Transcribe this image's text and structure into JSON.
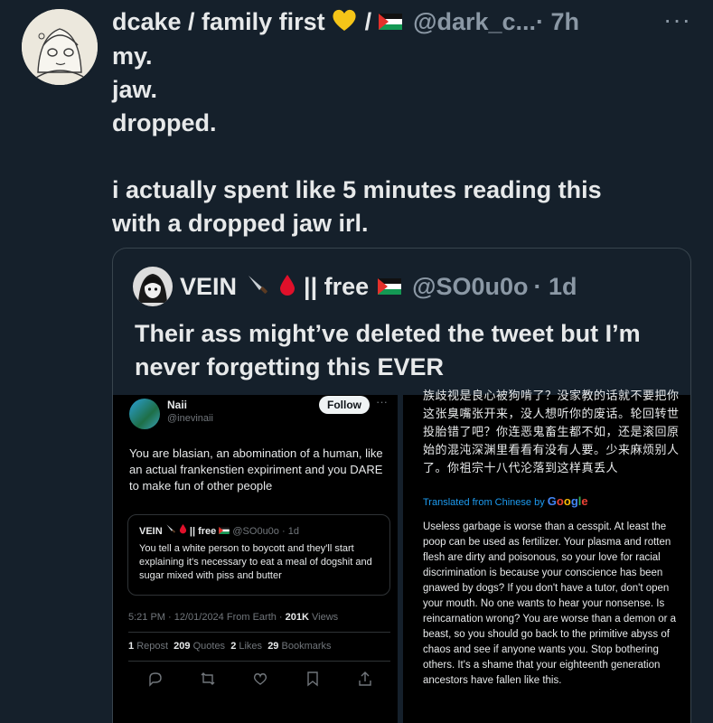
{
  "post": {
    "author_name": "dcake / family first",
    "separator": "/",
    "handle": "@dark_c...",
    "time": "· 7h",
    "more": "···",
    "text": "my.\njaw.\ndropped.\n\ni actually spent like 5 minutes reading this\nwith a dropped jaw irl."
  },
  "quote": {
    "author_name": "VEIN",
    "author_suffix": "|| free",
    "handle": "@SO0u0o",
    "time": "· 1d",
    "text": "Their ass might’ve deleted the tweet but I’m never forgetting this EVER"
  },
  "left_shot": {
    "name": "Naii",
    "handle": "@inevinaii",
    "follow_label": "Follow",
    "more": "···",
    "text": "You are blasian, an abomination of a human, like an actual frankenstien expiriment and you DARE to make fun of other people",
    "quoted": {
      "name": "VEIN",
      "suffix": "|| free",
      "handle": "@SO0u0o",
      "time": "· 1d",
      "text": "You tell a white person to boycott and they'll start explaining it's necessary to eat a meal of dogshit and sugar mixed with piss and butter"
    },
    "meta_time": "5:21 PM · 12/01/2024 From Earth ·",
    "views_count": "201K",
    "views_label": "Views",
    "stats": [
      {
        "count": "1",
        "label": "Repost"
      },
      {
        "count": "209",
        "label": "Quotes"
      },
      {
        "count": "2",
        "label": "Likes"
      },
      {
        "count": "29",
        "label": "Bookmarks"
      }
    ]
  },
  "right_shot": {
    "chinese_text": "族歧视是良心被狗啃了？没家教的话就不要把你这张臭嘴张开来，没人想听你的废话。轮回转世投胎错了吧？你连恶鬼畜生都不如，还是滚回原始的混沌深渊里看看有没有人要。少来麻烦别人了。你祖宗十八代沦落到这样真丢人",
    "translated_label": "Translated from Chinese by",
    "google": [
      "G",
      "o",
      "o",
      "g",
      "l",
      "e"
    ],
    "english_text": "Useless garbage is worse than a cesspit. At least the poop can be used as fertilizer. Your plasma and rotten flesh are dirty and poisonous, so your love for racial discrimination is because your conscience has been gnawed by dogs? If you don't have a tutor, don't open your mouth. No one wants to hear your nonsense. Is reincarnation wrong? You are worse than a demon or a beast, so you should go back to the primitive abyss of chaos and see if anyone wants you. Stop bothering others. It's a shame that your eighteenth generation ancestors have fallen like this."
  },
  "colors": {
    "background": "#15202b",
    "text": "#e7e9ea",
    "muted": "#8b98a5",
    "border": "#38444d",
    "link": "#1d9bf0"
  }
}
